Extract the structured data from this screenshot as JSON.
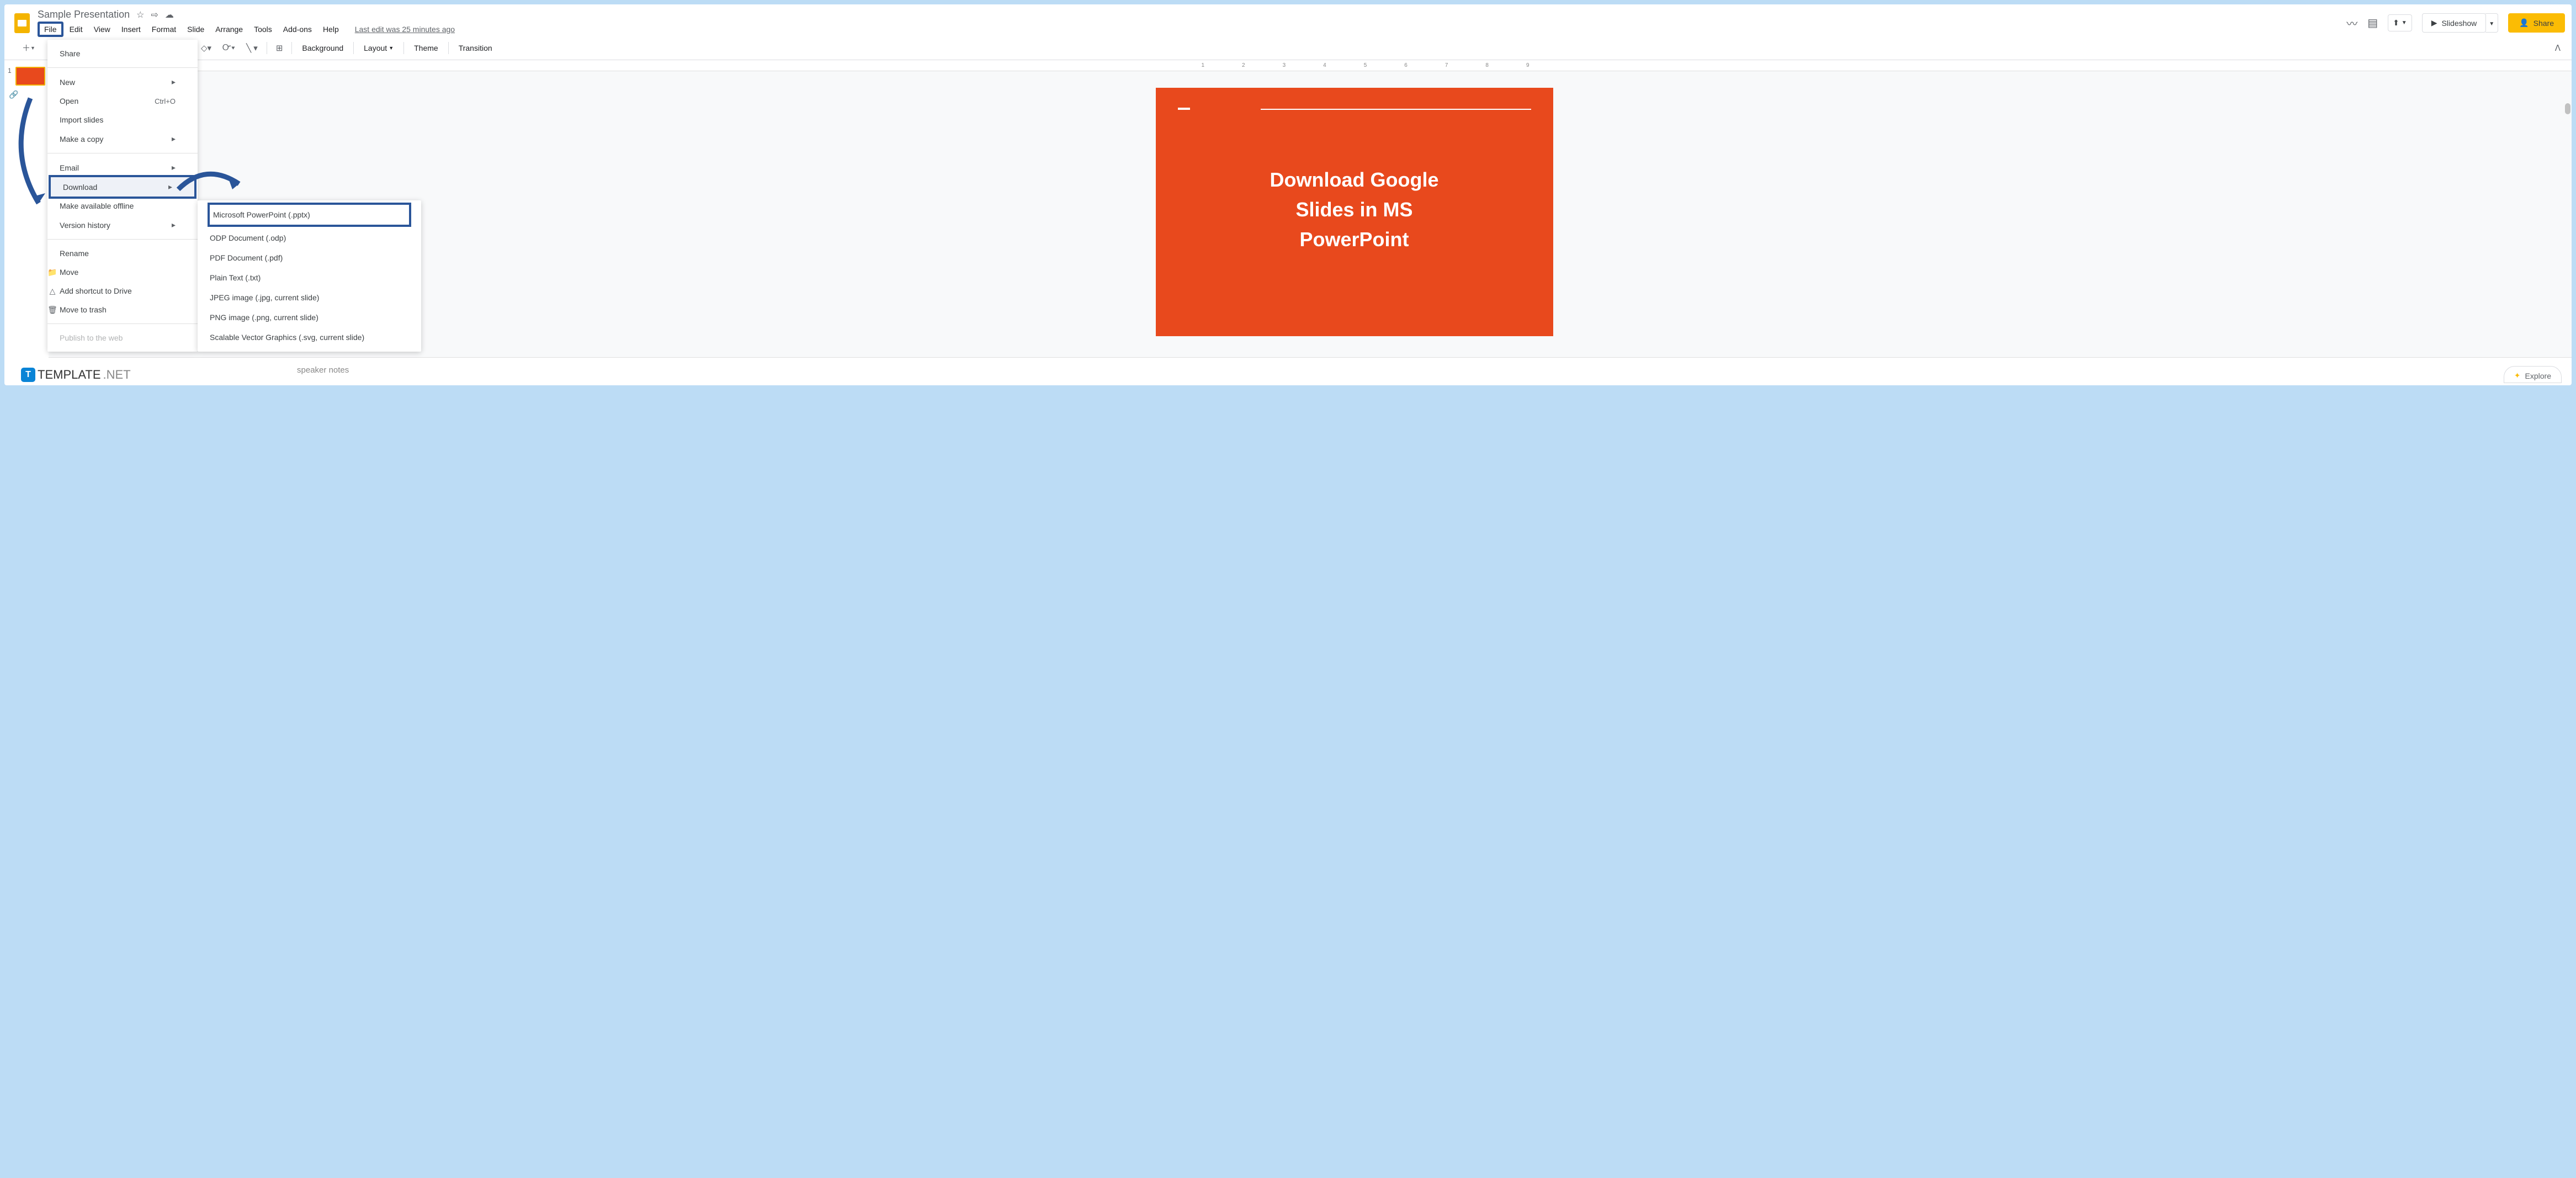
{
  "doc": {
    "title": "Sample Presentation",
    "last_edit": "Last edit was 25 minutes ago"
  },
  "menubar": {
    "file": "File",
    "edit": "Edit",
    "view": "View",
    "insert": "Insert",
    "format": "Format",
    "slide": "Slide",
    "arrange": "Arrange",
    "tools": "Tools",
    "addons": "Add-ons",
    "help": "Help"
  },
  "header": {
    "slideshow": "Slideshow",
    "share": "Share"
  },
  "toolbar": {
    "background": "Background",
    "layout": "Layout",
    "theme": "Theme",
    "transition": "Transition"
  },
  "filemenu": {
    "share": "Share",
    "new": "New",
    "open": "Open",
    "open_k": "Ctrl+O",
    "import": "Import slides",
    "copy": "Make a copy",
    "email": "Email",
    "download": "Download",
    "offline": "Make available offline",
    "history": "Version history",
    "rename": "Rename",
    "move": "Move",
    "shortcut": "Add shortcut to Drive",
    "trash": "Move to trash",
    "publish": "Publish to the web"
  },
  "download_sub": {
    "pptx": "Microsoft PowerPoint (.pptx)",
    "odp": "ODP Document (.odp)",
    "pdf": "PDF Document (.pdf)",
    "txt": "Plain Text (.txt)",
    "jpg": "JPEG image (.jpg, current slide)",
    "png": "PNG image (.png, current slide)",
    "svg": "Scalable Vector Graphics (.svg, current slide)"
  },
  "slide": {
    "l1": "Download Google",
    "l2": "Slides in MS",
    "l3": "PowerPoint"
  },
  "thumb": {
    "num": "1"
  },
  "ruler": [
    "1",
    "2",
    "3",
    "4",
    "5",
    "6",
    "7",
    "8",
    "9"
  ],
  "notes": "speaker notes",
  "explore": "Explore",
  "watermark": {
    "b": "TEMPLATE",
    "n": ".NET"
  }
}
